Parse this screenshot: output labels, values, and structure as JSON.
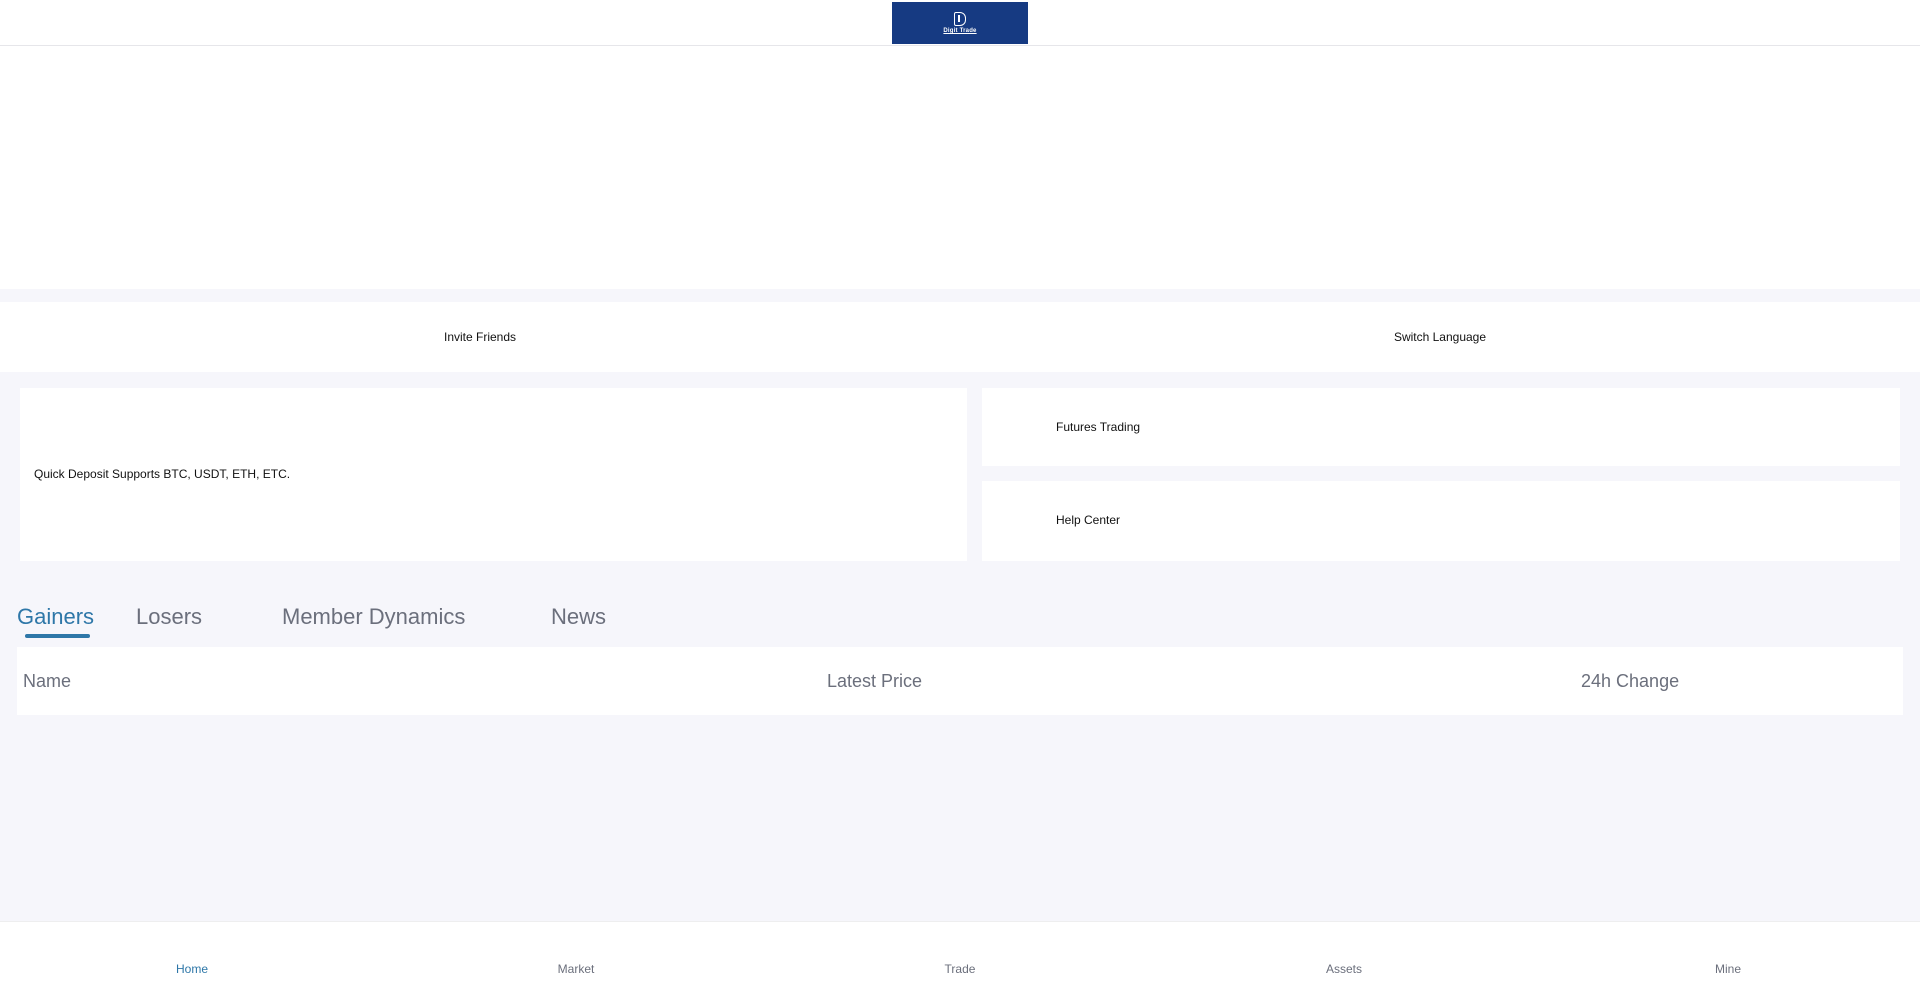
{
  "header": {
    "logo_text": "Digit Trade"
  },
  "shortcuts": [
    {
      "label": "Invite Friends"
    },
    {
      "label": "Switch Language"
    }
  ],
  "cards": {
    "deposit": "Quick Deposit Supports BTC, USDT, ETH, ETC.",
    "futures": "Futures Trading",
    "help": "Help Center"
  },
  "tabs": [
    {
      "label": "Gainers",
      "active": true
    },
    {
      "label": "Losers",
      "active": false
    },
    {
      "label": "Member Dynamics",
      "active": false
    },
    {
      "label": "News",
      "active": false
    }
  ],
  "table": {
    "columns": [
      "Name",
      "Latest Price",
      "24h Change"
    ]
  },
  "bottom_nav": [
    {
      "label": "Home",
      "active": true
    },
    {
      "label": "Market",
      "active": false
    },
    {
      "label": "Trade",
      "active": false
    },
    {
      "label": "Assets",
      "active": false
    },
    {
      "label": "Mine",
      "active": false
    }
  ],
  "colors": {
    "accent": "#2e77a8",
    "logo_bg": "#163a82",
    "page_bg": "#f6f6fb"
  }
}
